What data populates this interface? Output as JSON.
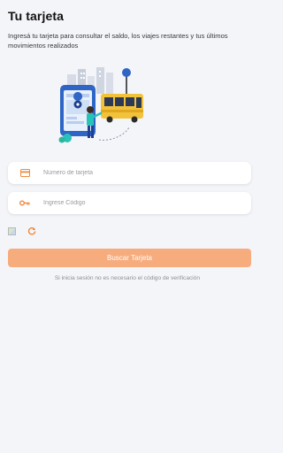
{
  "header": {
    "title": "Tu tarjeta",
    "description": "Ingresá tu tarjeta para consultar el saldo, los viajes restantes y tus últimos movimientos realizados"
  },
  "form": {
    "card_placeholder": "Número de tarjeta",
    "card_value": "",
    "card_icon": "credit-card-icon",
    "code_placeholder": "Ingrese Código",
    "code_value": "",
    "code_icon": "key-icon",
    "captcha_icon": "broken-image-icon",
    "refresh_icon": "refresh-icon",
    "submit_label": "Buscar Tarjeta"
  },
  "footer": {
    "hint": "Si inicia sesión no es necesario el código de verificación"
  },
  "colors": {
    "accent": "#f7ac7e",
    "icon_orange": "#f08a3c",
    "background": "#f4f5f9",
    "illustration_blue": "#2f66c6",
    "illustration_yellow": "#f2c23a",
    "illustration_teal": "#27c2b8"
  }
}
